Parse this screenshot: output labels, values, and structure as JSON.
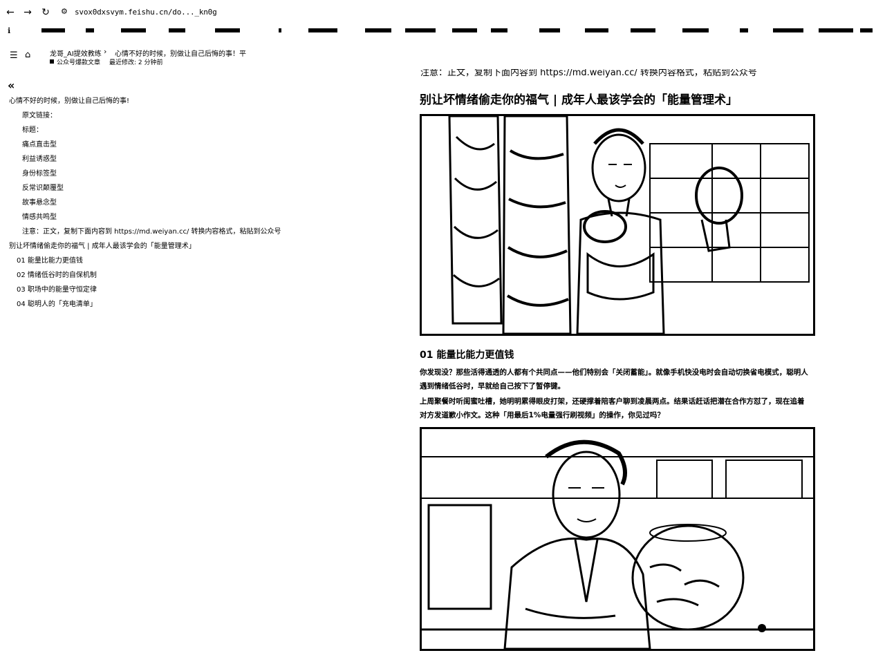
{
  "browser": {
    "back_icon": "←",
    "forward_icon": "→",
    "reload_icon": "↻",
    "site_icon": "⚙",
    "url": "svox0dxsvym.feishu.cn/do..._kn0g",
    "bookmark_first": "ℹ"
  },
  "header": {
    "toc_icon": "☰",
    "home_icon": "⌂",
    "space_name": "龙哥_AI提效教练",
    "separator": "›",
    "doc_name": "心情不好的时候，别做让自己后悔的事！平",
    "doc_type": "公众号爆款文章",
    "last_modified": "最近修改: 2 分钟前"
  },
  "outline": {
    "collapse_icon": "«",
    "items": [
      "心情不好的时候，别做让自己后悔的事!",
      "原文链接：",
      "标题：",
      "痛点直击型",
      "利益诱惑型",
      "身份标签型",
      "反常识颠覆型",
      "故事悬念型",
      "情感共鸣型",
      "注意：正文，复制下面内容到 https://md.weiyan.cc/ 转换内容格式，粘贴到公众号",
      "别让坏情绪偷走你的福气 | 成年人最该学会的「能量管理术」",
      "01 能量比能力更值钱",
      "02 情绪低谷时的自保机制",
      "03 职场中的能量守恒定律",
      "04 聪明人的「充电清单」"
    ]
  },
  "article": {
    "top_clipped": "注意：正文，复制下面内容到 https://md.weiyan.cc/ 转换内容格式，粘贴到公众号",
    "title": "别让坏情绪偷走你的福气 | 成年人最该学会的「能量管理术」",
    "section1_heading": "01 能量比能力更值钱",
    "para1": "你发现没？那些活得通透的人都有个共同点——他们特别会「关闭蓄能」。就像手机快没电时会自动切换省电模式，聪明人遇到情绪低谷时，早就给自己按下了暂停键。",
    "para2": "上周聚餐时听闺蜜吐槽，她明明累得眼皮打架，还硬撑着陪客户聊到凌晨两点。结果话赶话把潜在合作方怼了，现在追着对方发道歉小作文。这种「用最后1%电量强行刷视频」的操作，你见过吗？"
  }
}
